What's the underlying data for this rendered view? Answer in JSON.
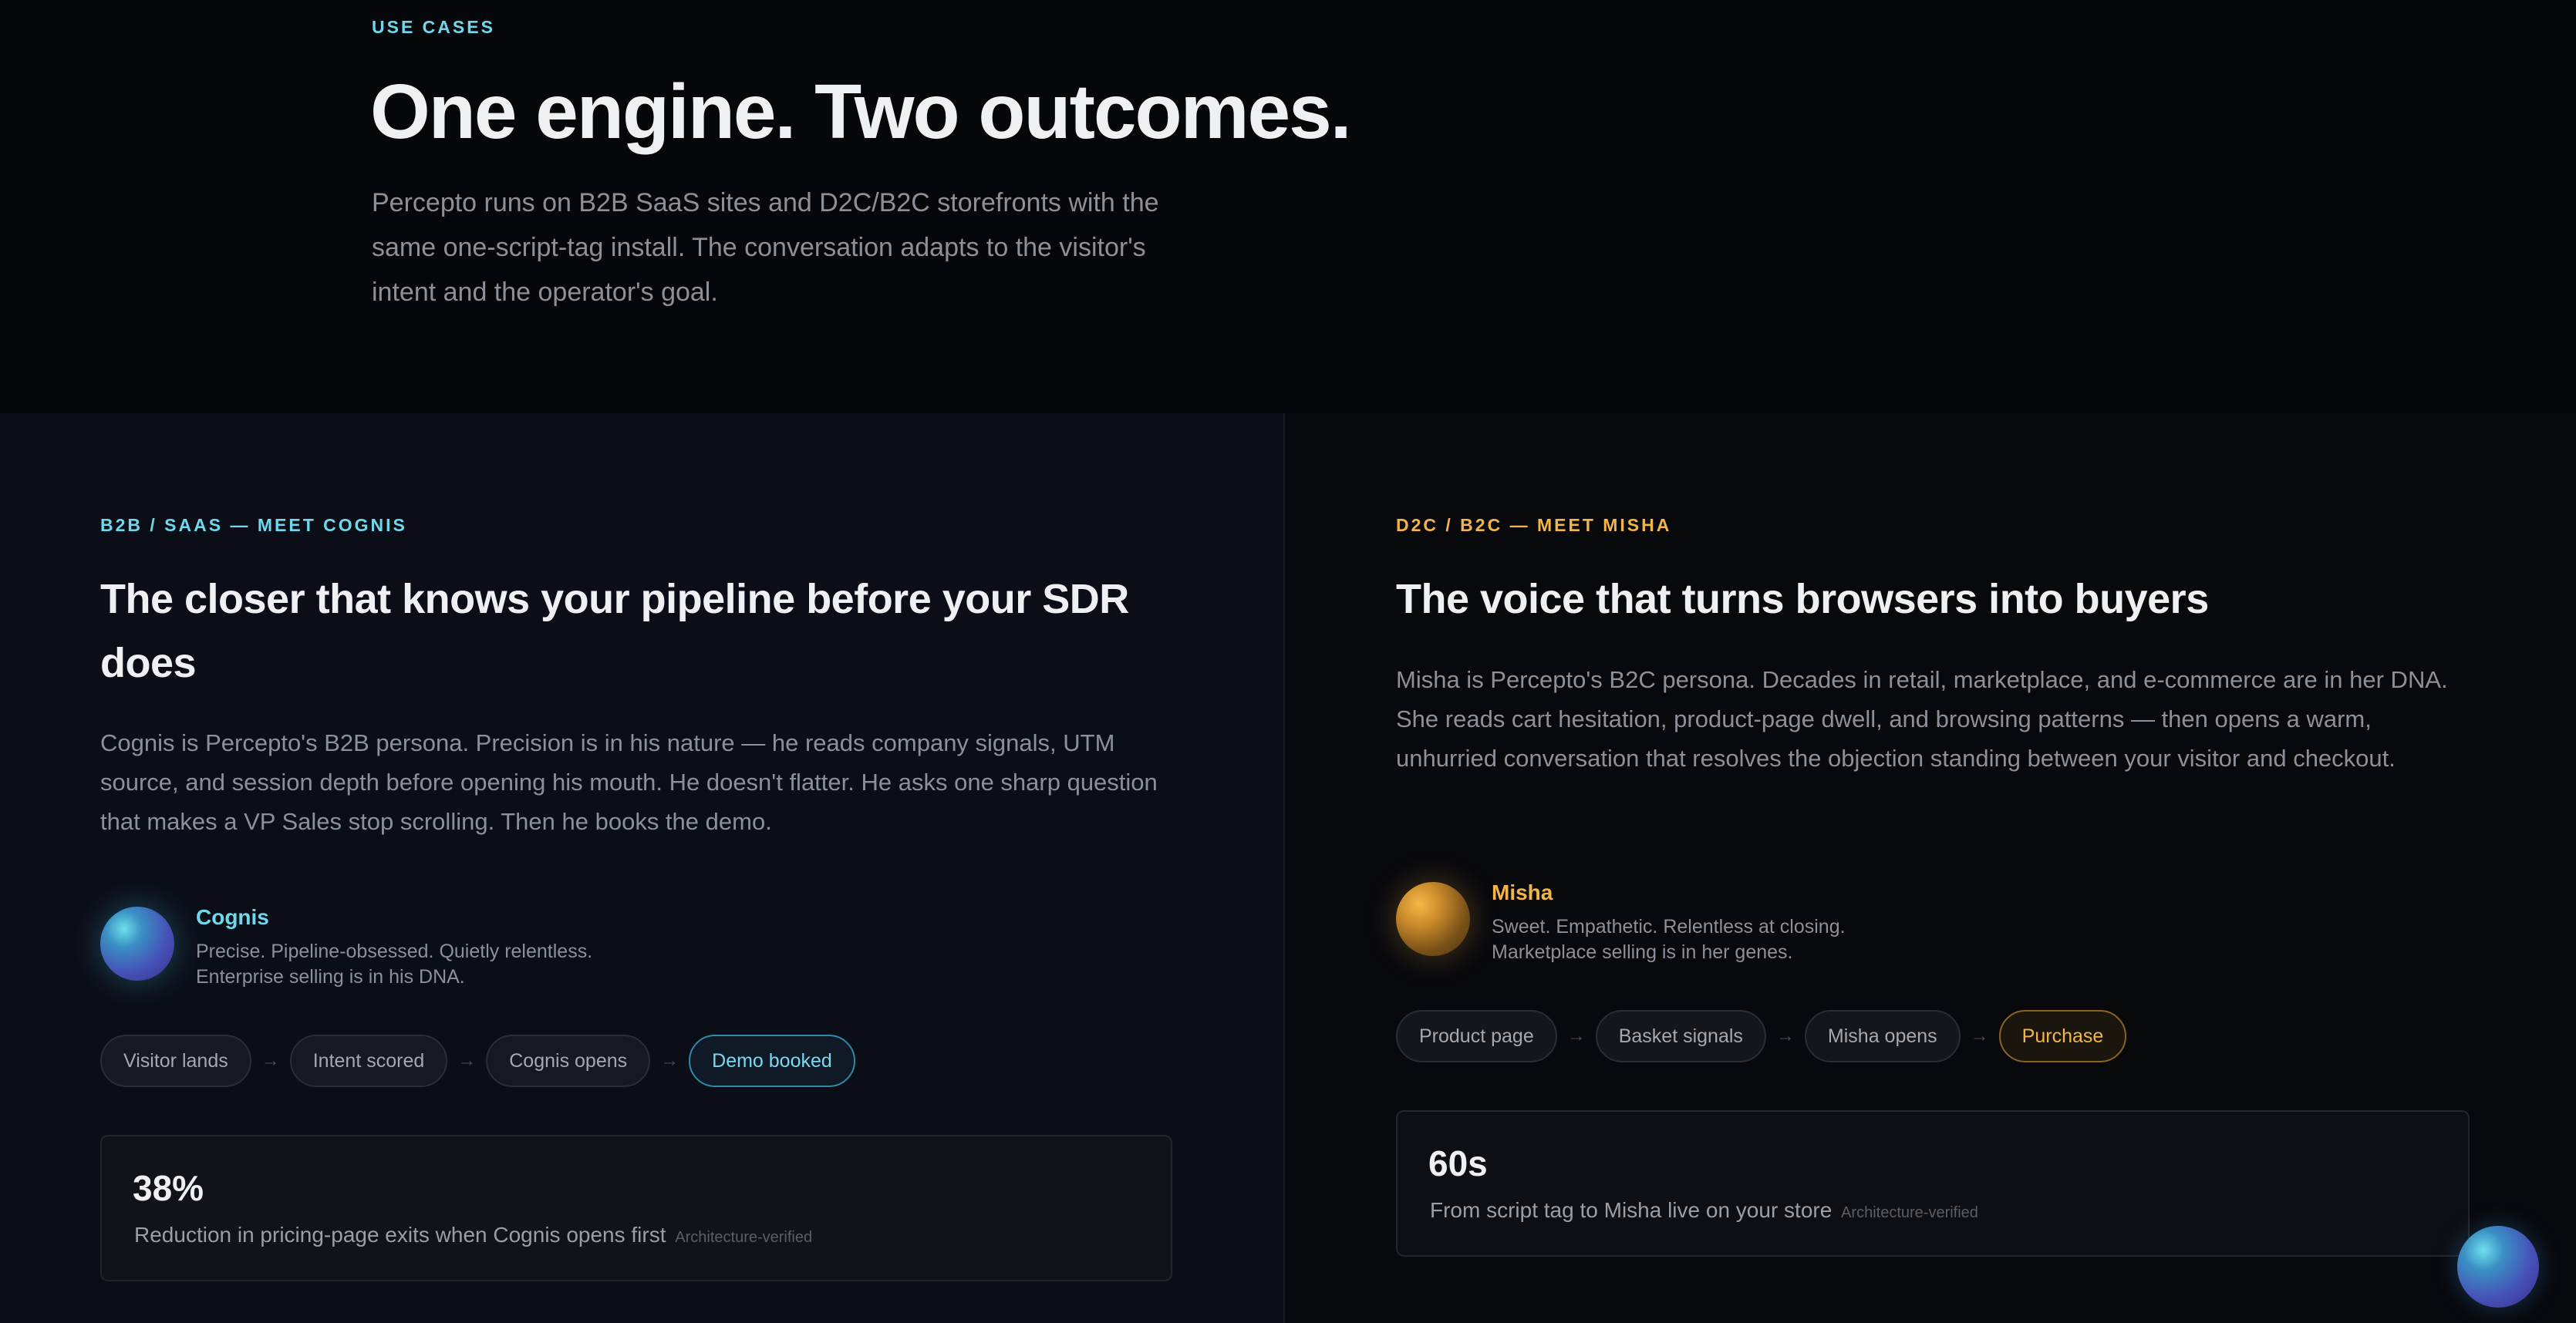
{
  "header": {
    "eyebrow": "USE CASES",
    "title": "One engine. Two outcomes.",
    "subtitle": "Percepto runs on B2B SaaS sites and D2C/B2C storefronts with the same one-script-tag install. The conversation adapts to the visitor's intent and the operator's goal."
  },
  "b2b": {
    "eyebrow": "B2B / SAAS — MEET COGNIS",
    "title": "The closer that knows your pipeline before your SDR does",
    "description": "Cognis is Percepto's B2B persona. Precision is in his nature — he reads company signals, UTM source, and session depth before opening his mouth. He doesn't flatter. He asks one sharp question that makes a VP Sales stop scrolling. Then he books the demo.",
    "persona": {
      "name": "Cognis",
      "line1": "Precise. Pipeline-obsessed. Quietly relentless.",
      "line2": "Enterprise selling is in his DNA."
    },
    "flow": [
      "Visitor lands",
      "Intent scored",
      "Cognis opens",
      "Demo booked"
    ],
    "stat": {
      "value": "38%",
      "label": "Reduction in pricing-page exits when Cognis opens first",
      "tag": "Architecture-verified"
    },
    "accent": "#6fd8ec"
  },
  "b2c": {
    "eyebrow": "D2C / B2C — MEET MISHA",
    "title": "The voice that turns browsers into buyers",
    "description": "Misha is Percepto's B2C persona. Decades in retail, marketplace, and e-commerce are in her DNA. She reads cart hesitation, product-page dwell, and browsing patterns — then opens a warm, unhurried conversation that resolves the objection standing between your visitor and checkout.",
    "persona": {
      "name": "Misha",
      "line1": "Sweet. Empathetic. Relentless at closing.",
      "line2": "Marketplace selling is in her genes."
    },
    "flow": [
      "Product page",
      "Basket signals",
      "Misha opens",
      "Purchase"
    ],
    "stat": {
      "value": "60s",
      "label": "From script tag to Misha live on your store",
      "tag": "Architecture-verified"
    },
    "accent": "#f3b54a"
  },
  "arrow_glyph": "→"
}
